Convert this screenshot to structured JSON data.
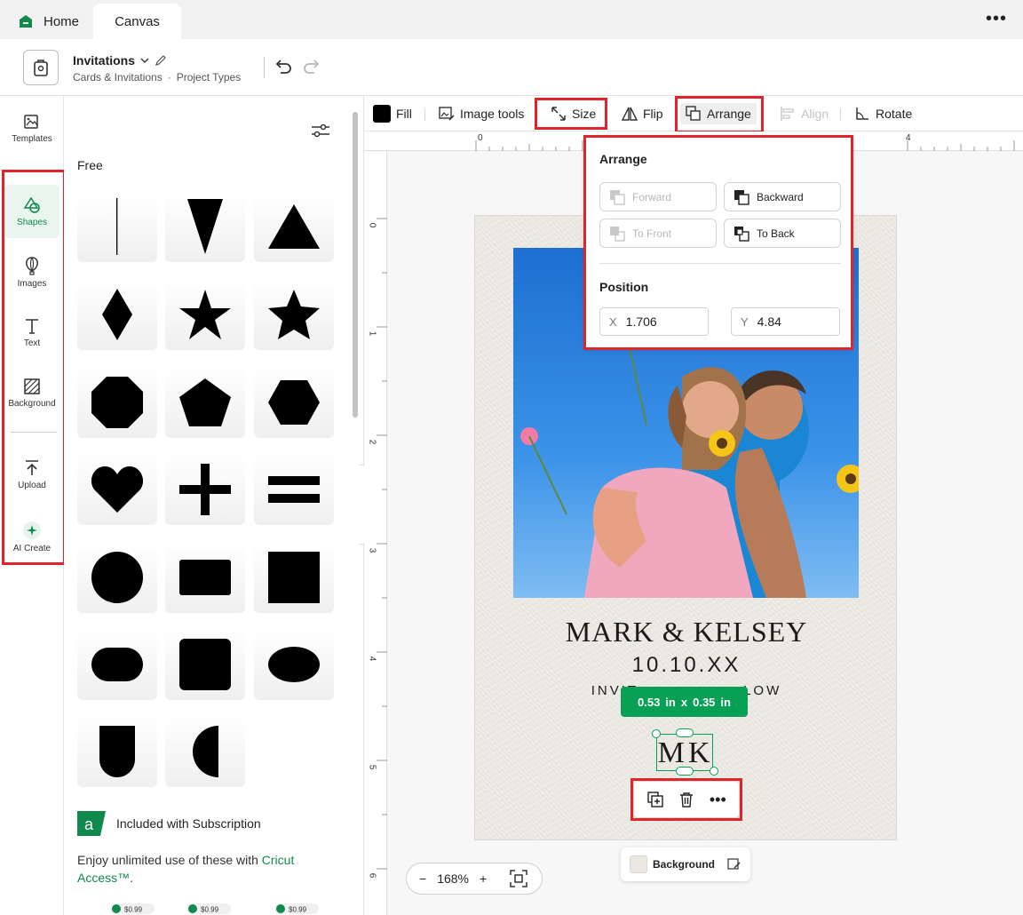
{
  "tabs": {
    "home": "Home",
    "canvas": "Canvas"
  },
  "header": {
    "title": "Invitations",
    "breadcrumb_1": "Cards & Invitations",
    "breadcrumb_sep": "·",
    "breadcrumb_2": "Project Types"
  },
  "rail": {
    "templates": "Templates",
    "shapes": "Shapes",
    "images": "Images",
    "text": "Text",
    "background": "Background",
    "upload": "Upload",
    "ai_create": "AI Create"
  },
  "panel": {
    "free_label": "Free",
    "subscription_label": "Included with Subscription",
    "access_text": "Enjoy unlimited use of these with ",
    "access_link": "Cricut Access™",
    "access_end": ".",
    "promo_price": "$0.99"
  },
  "toolbar": {
    "fill": "Fill",
    "image_tools": "Image tools",
    "size": "Size",
    "flip": "Flip",
    "arrange": "Arrange",
    "align": "Align",
    "rotate": "Rotate"
  },
  "ruler": {
    "top": [
      "0",
      "4"
    ],
    "left": [
      "0",
      "1",
      "2",
      "3",
      "4",
      "5",
      "6"
    ]
  },
  "card": {
    "names": "MARK & KELSEY",
    "date": "10.10.XX",
    "invite_left": "INVIT",
    "invite_right": "LOW",
    "monogram": "MK"
  },
  "selection": {
    "width": "0.53",
    "height": "0.35",
    "unit": "in",
    "sep": "x"
  },
  "arrange_popover": {
    "title": "Arrange",
    "forward": "Forward",
    "backward": "Backward",
    "to_front": "To Front",
    "to_back": "To Back",
    "position_title": "Position",
    "x_label": "X",
    "x_value": "1.706",
    "y_label": "Y",
    "y_value": "4.84"
  },
  "background_chip": "Background",
  "zoom": {
    "minus": "−",
    "value": "168%",
    "plus": "+"
  },
  "colors": {
    "accent_green": "#07a055",
    "highlight_red": "#e0242b"
  }
}
